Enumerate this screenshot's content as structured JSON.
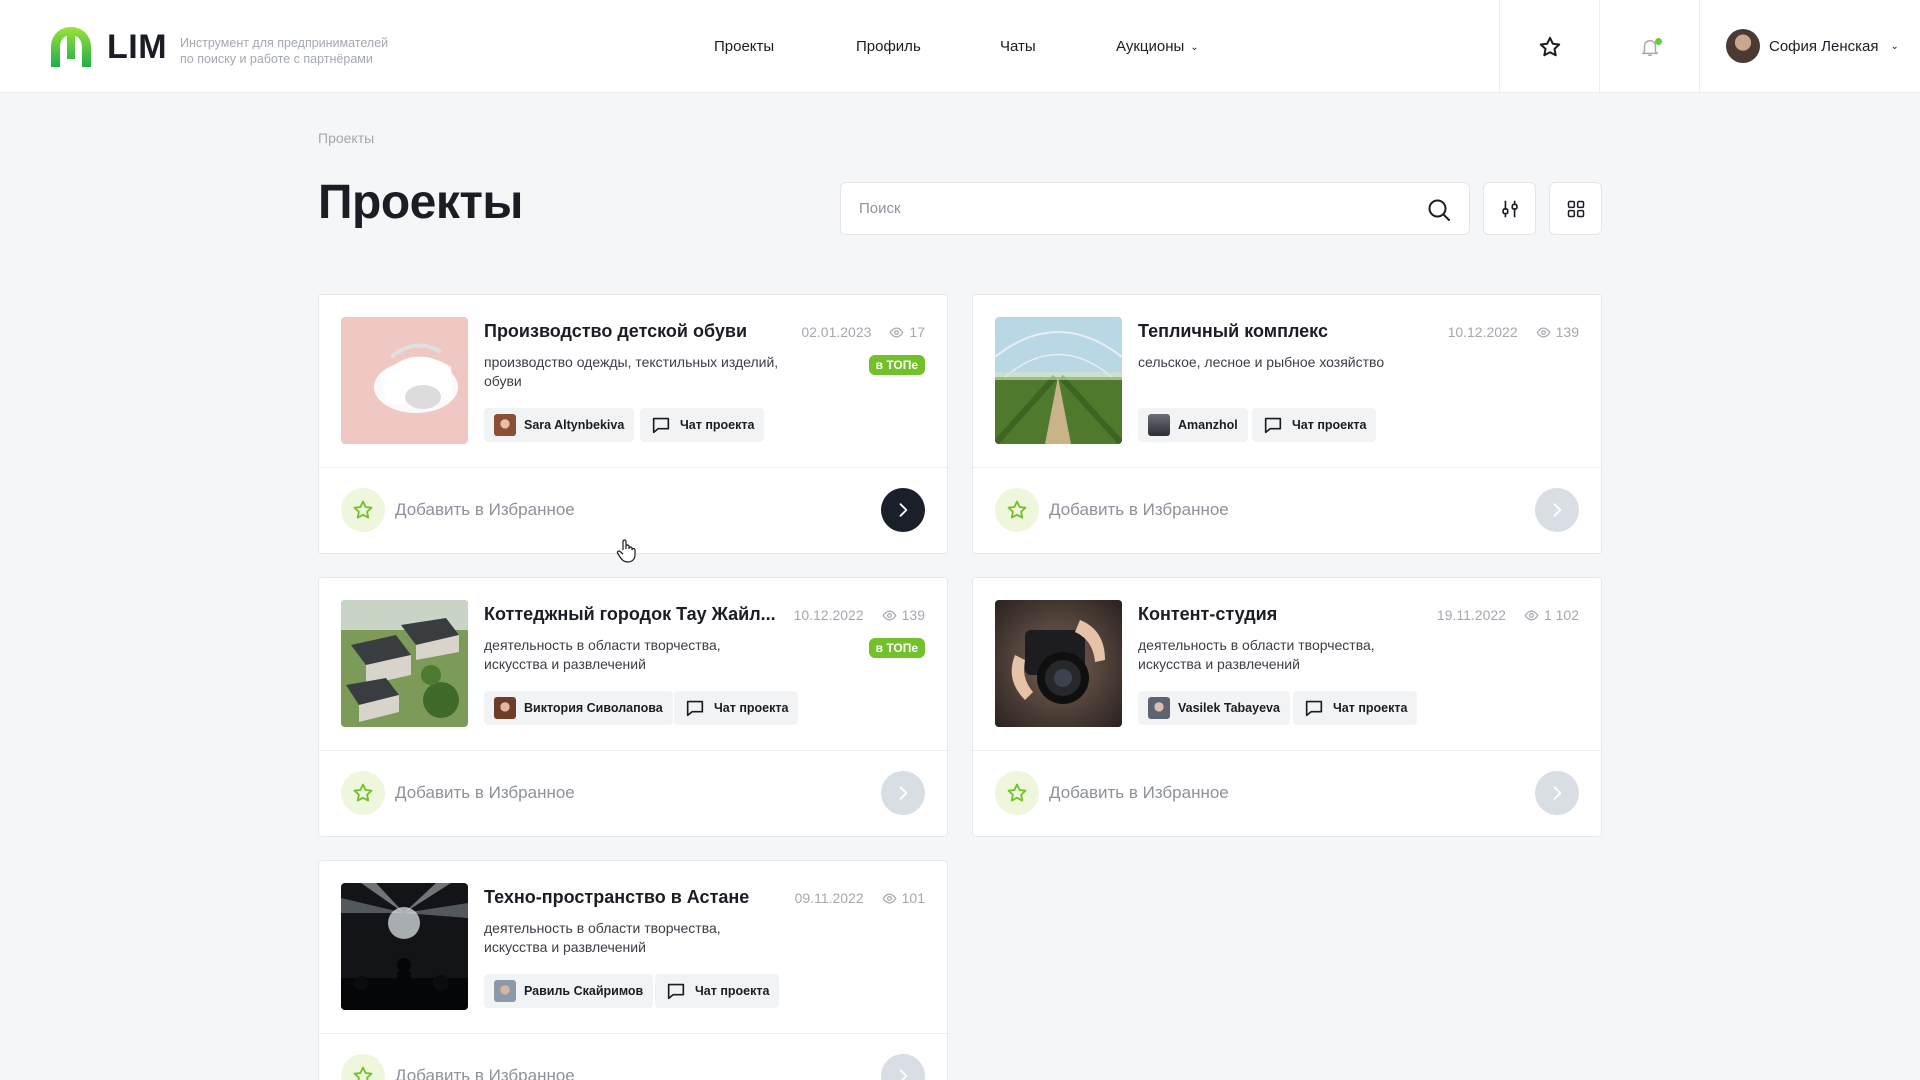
{
  "header": {
    "logo_text": "LIM",
    "tagline_line1": "Инструмент для предпринимателей",
    "tagline_line2": "по поиску и работе с партнёрами",
    "nav": [
      {
        "label": "Проекты"
      },
      {
        "label": "Профиль"
      },
      {
        "label": "Чаты"
      },
      {
        "label": "Аукционы"
      }
    ],
    "user_name": "София Ленская",
    "icons": {
      "favorites": "star-icon",
      "notifications": "bell-icon",
      "user_menu": "chevron-down-icon"
    },
    "notification_dot_color": "#5fcf3a"
  },
  "page": {
    "breadcrumb": "Проекты",
    "title": "Проекты",
    "search_placeholder": "Поиск"
  },
  "common": {
    "favorite_label": "Добавить в Избранное",
    "chat_label": "Чат проекта",
    "top_badge": "в ТОПе"
  },
  "colors": {
    "accent_green": "#72c02a",
    "dark_button": "#1b1f2a",
    "muted_button": "#d9dde4"
  },
  "projects": [
    {
      "title": "Производство детской обуви",
      "date": "02.01.2023",
      "views": "17",
      "desc": "производство одежды, текстильных изделий, обуви",
      "author": "Sara Altynbekiva",
      "top": true,
      "image": "baby-shoes-photo"
    },
    {
      "title": "Тепличный комплекс",
      "date": "10.12.2022",
      "views": "139",
      "desc": "сельское, лесное и рыбное хозяйство",
      "author": "Amanzhol",
      "top": false,
      "image": "greenhouse-photo"
    },
    {
      "title": "Коттеджный городок Тау Жайл...",
      "date": "10.12.2022",
      "views": "139",
      "desc": "деятельность в области творчества, искусства и развлечений",
      "author": "Виктория Сиволапова",
      "top": true,
      "image": "cottage-town-photo"
    },
    {
      "title": "Контент-студия",
      "date": "19.11.2022",
      "views": "1 102",
      "desc": "деятельность в области творчества, искусства и развлечений",
      "author": "Vasilek Tabayeva",
      "top": false,
      "image": "camera-photo"
    },
    {
      "title": "Техно-пространство в Астане",
      "date": "09.11.2022",
      "views": "101",
      "desc": "деятельность в области творчества, искусства и развлечений",
      "author": "Равиль Скайримов",
      "top": false,
      "image": "concert-photo"
    }
  ]
}
